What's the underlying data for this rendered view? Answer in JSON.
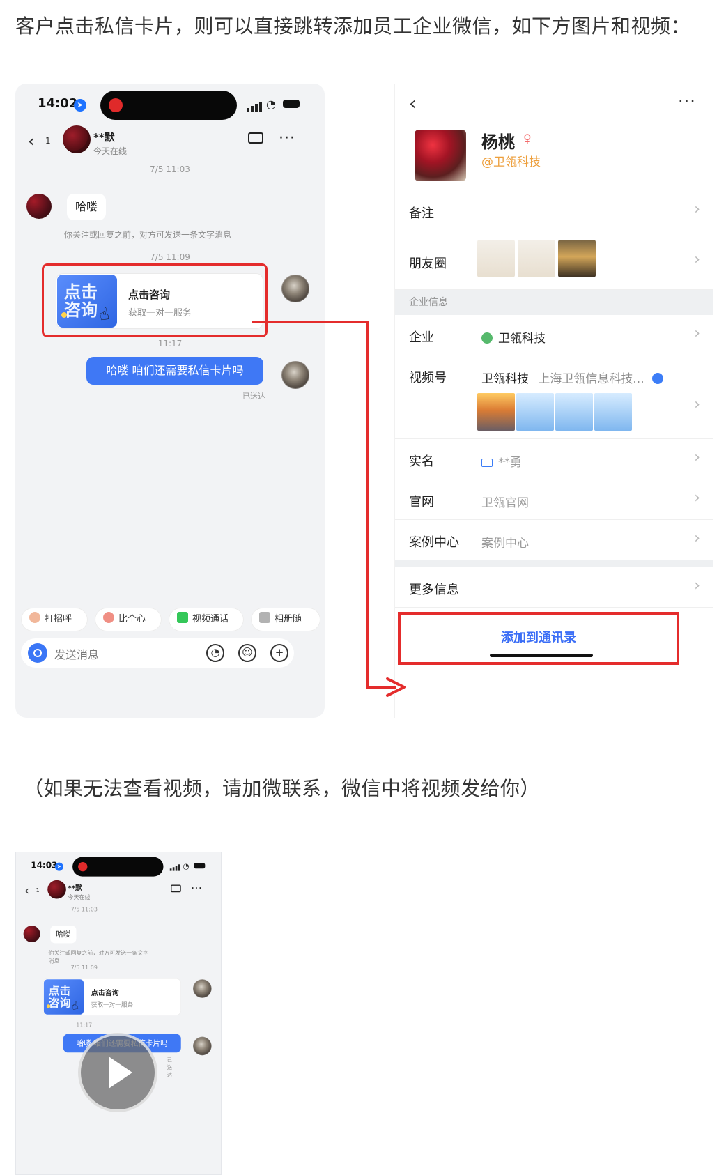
{
  "intro": {
    "text": "客户点击私信卡片，则可以直接跳转添加员工企业微信，如下方图片和视频："
  },
  "left_phone": {
    "status": {
      "time": "14:02"
    },
    "header": {
      "unread": "1",
      "name": "**默",
      "status": "今天在线"
    },
    "messages": {
      "time_1": "7/5 11:03",
      "greeting": "哈喽",
      "system_note": "你关注或回复之前，对方可发送一条文字消息",
      "time_2": "7/5 11:09",
      "card_title": "点击咨询",
      "card_subtitle": "获取一对一服务",
      "card_badge": "点击\n咨询",
      "time_3": "11:17",
      "reply": "哈喽 咱们还需要私信卡片吗",
      "sent": "已送达"
    },
    "quick_actions": [
      "打招呼",
      "比个心",
      "视频通话",
      "相册随"
    ],
    "input": {
      "placeholder": "发送消息"
    }
  },
  "right_panel": {
    "profile": {
      "name": "杨桃",
      "company": "@卫瓴科技"
    },
    "rows": {
      "note": "备注",
      "moments": "朋友圈",
      "section": "企业信息",
      "enterprise_label": "企业",
      "enterprise_value": "卫瓴科技",
      "channels_label": "视频号",
      "channels_value": "卫瓴科技",
      "channels_desc": "上海卫瓴信息科技...",
      "realname_label": "实名",
      "realname_value": "**勇",
      "website_label": "官网",
      "website_value": "卫瓴官网",
      "cases_label": "案例中心",
      "cases_value": "案例中心",
      "more_label": "更多信息"
    },
    "button": {
      "label": "添加到通讯录"
    }
  },
  "note": {
    "text": "（如果无法查看视频，请加微联系，微信中将视频发给你）"
  },
  "video_preview": {
    "time": "14:03",
    "name": "**默",
    "status": "今天在线",
    "time_1": "7/5 11:03",
    "greeting": "哈喽",
    "system_note": "你关注或回复之前，对方可发送一条文字消息",
    "time_2": "7/5 11:09",
    "card_title": "点击咨询",
    "card_subtitle": "获取一对一服务",
    "card_badge": "点击\n咨询",
    "time_3": "11:17",
    "reply": "哈喽 咱们还需要私信卡片吗",
    "sent": "已送达"
  },
  "colors": {
    "accent": "#e42c2c",
    "blue": "#3f78f5",
    "orange": "#ed9f3d"
  }
}
